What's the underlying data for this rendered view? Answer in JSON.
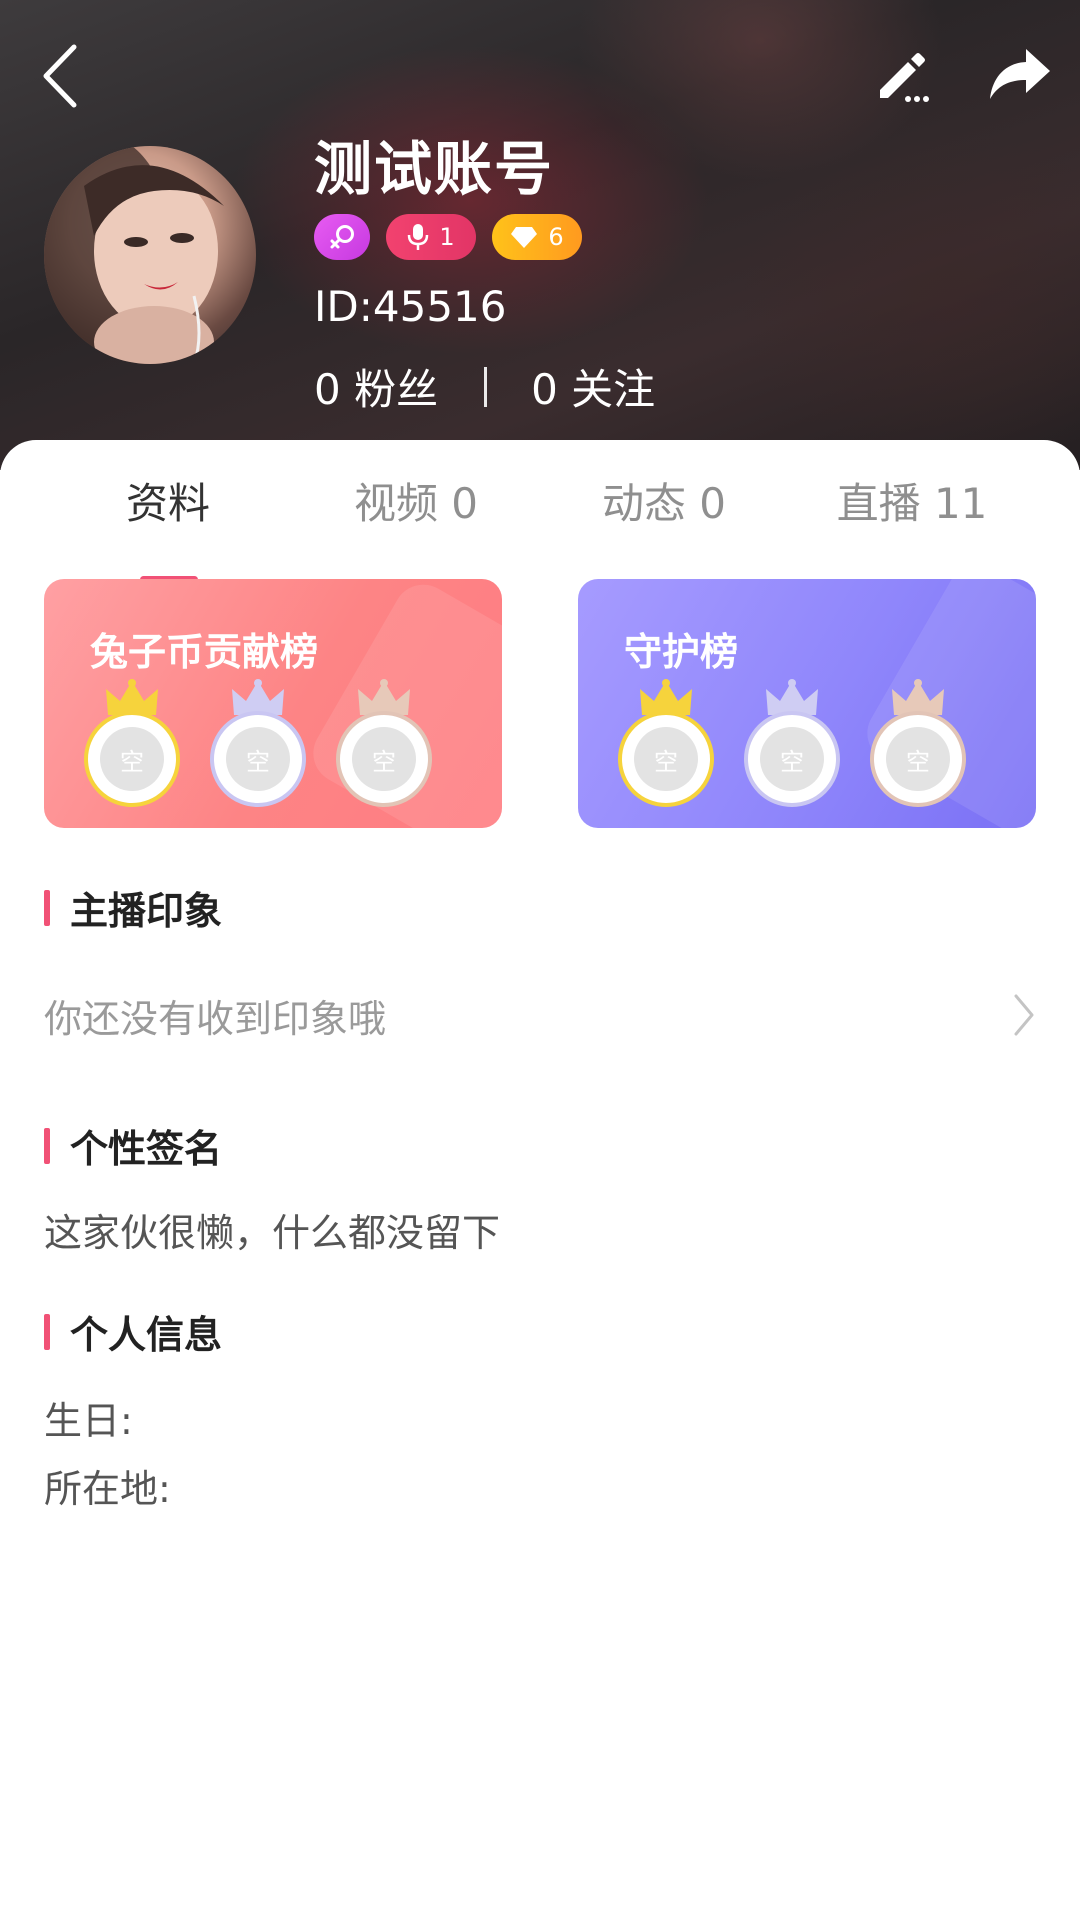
{
  "header": {
    "nickname": "测试账号",
    "user_id": "ID:45516",
    "badges": {
      "anchor_level": "1",
      "wealth_level": "6"
    },
    "stats": {
      "fans": "0 粉丝",
      "following": "0 关注"
    },
    "icons": {
      "back": "chevron-left-icon",
      "edit": "pencil-icon",
      "share": "share-arrow-icon",
      "gender": "female-icon",
      "anchor": "microphone-icon",
      "wealth": "diamond-icon"
    }
  },
  "tabs": [
    {
      "label": "资料",
      "active": true
    },
    {
      "label": "视频 0",
      "active": false
    },
    {
      "label": "动态 0",
      "active": false
    },
    {
      "label": "直播 11",
      "active": false
    }
  ],
  "rank_cards": [
    {
      "title": "兔子币贡献榜",
      "slots": [
        "空",
        "空",
        "空"
      ]
    },
    {
      "title": "守护榜",
      "slots": [
        "空",
        "空",
        "空"
      ]
    }
  ],
  "sections": {
    "impression": {
      "title": "主播印象",
      "text": "你还没有收到印象哦"
    },
    "signature": {
      "title": "个性签名",
      "text": "这家伙很懒，什么都没留下"
    },
    "info": {
      "title": "个人信息",
      "birthday": "生日:",
      "location": "所在地:"
    }
  },
  "colors": {
    "accent": "#f15176",
    "coin_card": "#fd8485",
    "guard_card": "#8f86fb",
    "gold": "#f6d33c",
    "silver": "#c9c6f2",
    "bronze": "#e2c4b6"
  }
}
